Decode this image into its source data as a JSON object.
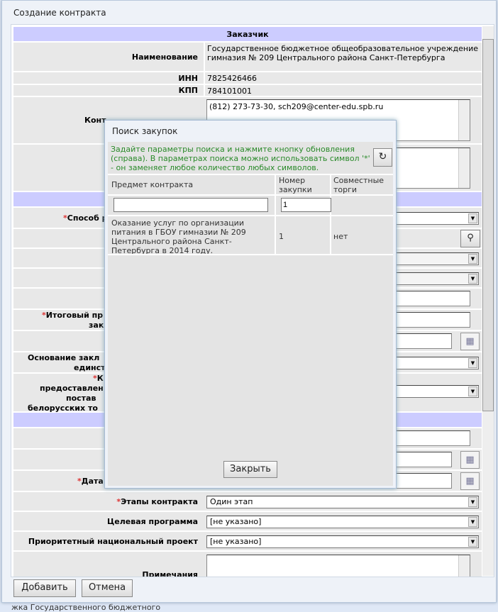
{
  "window": {
    "title": "Создание контракта"
  },
  "form": {
    "customer_header": "Заказчик",
    "name_label": "Наименование",
    "name_value": "Государственное бюджетное общеобразовательное учреждение гимназия № 209 Центрального района Санкт-Петербурга",
    "inn_label": "ИНН",
    "inn_value": "7825426466",
    "kpp_label": "КПП",
    "kpp_value": "784101001",
    "contact_label": "Конт",
    "contact_value": "(812) 273-73-30, sch209@center-edu.spb.ru",
    "method_label": "Способ р",
    "final_price_label": "Итоговый пр",
    "final_price_label2": "закл",
    "basis_label": "Основание закл",
    "basis_label2": "единстве",
    "coef_label": "К",
    "coef_label2": "предоставлен",
    "coef_label3": "постав",
    "coef_label4": "белорусских то",
    "date_label": "Дата",
    "stages_label": "Этапы контракта",
    "stages_value": "Один этап",
    "program_label": "Целевая программа",
    "program_value": "[не указано]",
    "project_label": "Приоритетный национальный проект",
    "project_value": "[не указано]",
    "notes_label": "Примечания"
  },
  "buttons": {
    "add": "Добавить",
    "cancel": "Отмена"
  },
  "background_text": "жка Государственного бюджетного",
  "popup": {
    "title": "Поиск закупок",
    "hint": "Задайте параметры поиска и нажмите кнопку обновления (справа). В параметрах поиска можно использовать символ '*' - он заменяет любое количество любых символов.",
    "col_subject": "Предмет контракта",
    "col_number": "Номер закупки",
    "col_joint": "Совместные торги",
    "filter_subject": "",
    "filter_number": "1",
    "results": [
      {
        "subject": "Оказание услуг по организации питания в ГБОУ гимназии № 209 Центрального района Санкт-Петербурга в 2014 году.",
        "number": "1",
        "joint": "нет"
      }
    ],
    "close": "Закрыть"
  },
  "colors": {
    "section": "#ccccff",
    "hint": "#2a8a2a",
    "required": "#dd3333"
  }
}
